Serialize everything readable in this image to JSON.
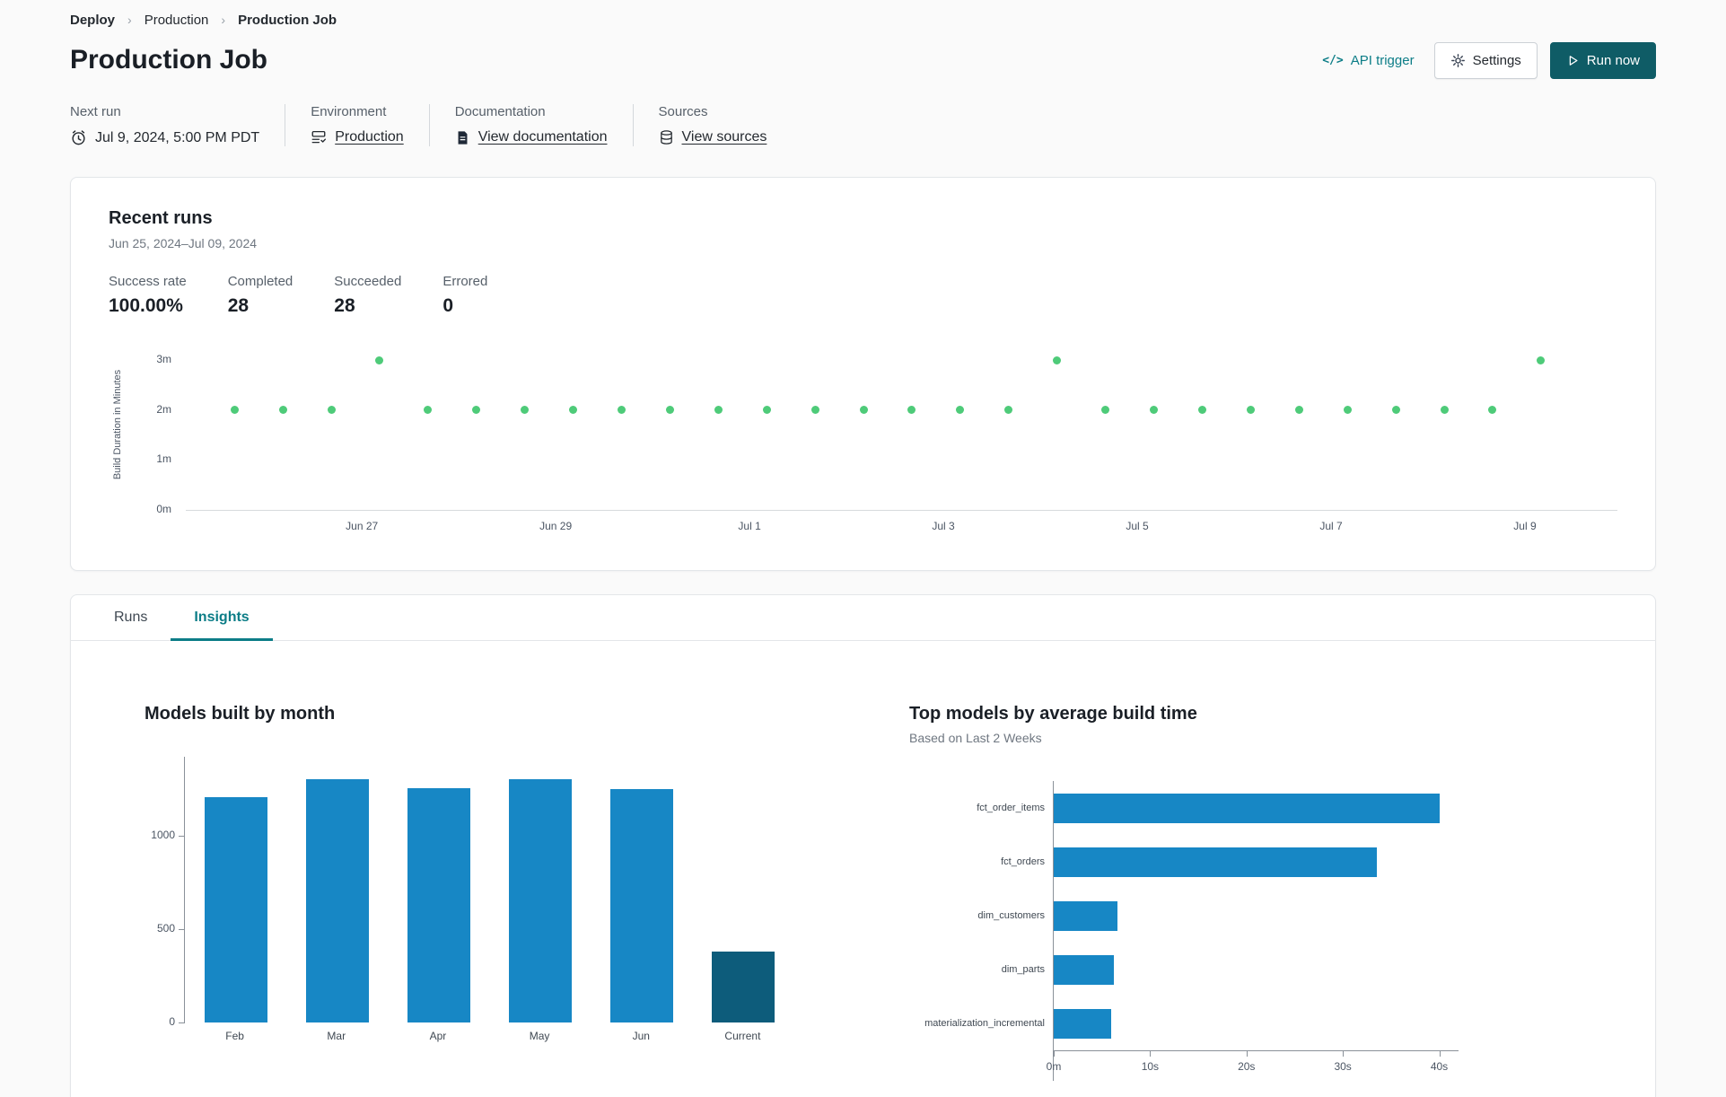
{
  "colors": {
    "accent_teal": "#0c7d87",
    "run_button_teal": "#0f5c66",
    "link_text": "#24292f",
    "success_dot_green": "#4ecb79",
    "bar_blue": "#1787c5",
    "bar_dark_blue": "#0d5c7b"
  },
  "breadcrumb": {
    "items": [
      {
        "label": "Deploy"
      },
      {
        "label": "Production"
      },
      {
        "label": "Production Job"
      }
    ]
  },
  "header": {
    "title": "Production Job",
    "api_trigger": "API trigger",
    "settings": "Settings",
    "run_now": "Run now"
  },
  "meta": {
    "next_run_label": "Next run",
    "next_run_value": "Jul 9, 2024, 5:00 PM PDT",
    "environment_label": "Environment",
    "environment_value": "Production",
    "documentation_label": "Documentation",
    "documentation_value": "View documentation",
    "sources_label": "Sources",
    "sources_value": "View sources"
  },
  "recent_runs": {
    "title": "Recent runs",
    "date_range": "Jun 25, 2024–Jul 09, 2024",
    "stats": [
      {
        "label": "Success rate",
        "value": "100.00%"
      },
      {
        "label": "Completed",
        "value": "28"
      },
      {
        "label": "Succeeded",
        "value": "28"
      },
      {
        "label": "Errored",
        "value": "0"
      }
    ]
  },
  "tabs": [
    {
      "label": "Runs",
      "active": false
    },
    {
      "label": "Insights",
      "active": true
    }
  ],
  "chart_data": [
    {
      "type": "scatter",
      "title": "Recent runs build duration",
      "ylabel": "Build Duration in Minutes",
      "y_tick_labels": [
        "0m",
        "1m",
        "2m",
        "3m"
      ],
      "ylim_minutes": [
        0,
        3.4
      ],
      "x_tick_labels": [
        "Jun 27",
        "Jun 29",
        "Jul 1",
        "Jul 3",
        "Jul 5",
        "Jul 7",
        "Jul 9"
      ],
      "point_color": "#4ecb79",
      "points_build_minutes": [
        2,
        2,
        2,
        3,
        2,
        2,
        2,
        2,
        2,
        2,
        2,
        2,
        2,
        2,
        2,
        2,
        2,
        3,
        2,
        2,
        2,
        2,
        2,
        2,
        2,
        2,
        2,
        3
      ]
    },
    {
      "type": "bar",
      "title": "Models built by month",
      "categories": [
        "Feb",
        "Mar",
        "Apr",
        "May",
        "Jun",
        "Current"
      ],
      "values": [
        1205,
        1300,
        1250,
        1300,
        1245,
        380
      ],
      "y_ticks": [
        0,
        500,
        1000
      ],
      "ylim": [
        0,
        1420
      ],
      "grid": false,
      "bar_color": "#1787c5",
      "highlight_index": 5,
      "highlight_color": "#0d5c7b"
    },
    {
      "type": "hbar",
      "title": "Top models by average build time",
      "subtitle": "Based on Last 2 Weeks",
      "categories": [
        "fct_order_items",
        "fct_orders",
        "dim_customers",
        "dim_parts",
        "materialization_incremental"
      ],
      "values_seconds": [
        40,
        33.5,
        6.6,
        6.2,
        6.0
      ],
      "x_tick_labels": [
        "0m",
        "10s",
        "20s",
        "30s",
        "40s"
      ],
      "x_tick_seconds": [
        0,
        10,
        20,
        30,
        40
      ],
      "xlim_seconds": [
        0,
        42
      ],
      "bar_color": "#1787c5"
    }
  ]
}
